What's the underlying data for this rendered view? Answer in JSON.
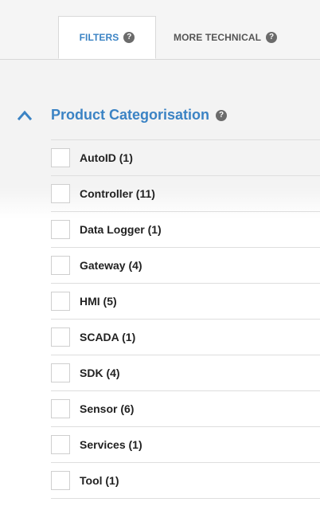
{
  "tabs": [
    {
      "label": "FILTERS",
      "active": true
    },
    {
      "label": "MORE TECHNICAL",
      "active": false
    }
  ],
  "help_glyph": "?",
  "section": {
    "title": "Product Categorisation",
    "expanded": true,
    "items": [
      {
        "label": "AutoID (1)",
        "checked": false
      },
      {
        "label": "Controller (11)",
        "checked": false
      },
      {
        "label": "Data Logger (1)",
        "checked": false
      },
      {
        "label": "Gateway (4)",
        "checked": false
      },
      {
        "label": "HMI (5)",
        "checked": false
      },
      {
        "label": "SCADA (1)",
        "checked": false
      },
      {
        "label": "SDK (4)",
        "checked": false
      },
      {
        "label": "Sensor (6)",
        "checked": false
      },
      {
        "label": "Services (1)",
        "checked": false
      },
      {
        "label": "Tool (1)",
        "checked": false
      }
    ]
  },
  "colors": {
    "accent": "#3b83c4",
    "help_badge": "#6b6b6b"
  },
  "icons": [
    "help-icon",
    "chevron-up-icon"
  ]
}
